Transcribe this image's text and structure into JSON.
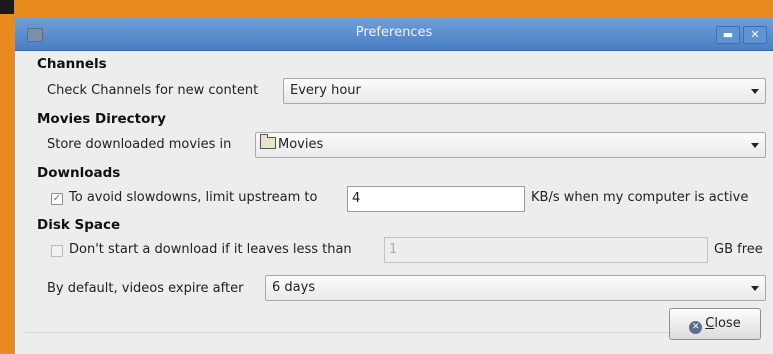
{
  "window": {
    "title": "Preferences",
    "minimize_glyph": "▬",
    "close_glyph": "✕"
  },
  "channels": {
    "heading": "Channels",
    "check_label": "Check Channels for new content",
    "check_value": "Every hour"
  },
  "movies": {
    "heading": "Movies Directory",
    "store_label": "Store downloaded movies in",
    "store_value": "Movies"
  },
  "downloads": {
    "heading": "Downloads",
    "limit_checked": true,
    "limit_check_glyph": "✓",
    "limit_label": "To avoid slowdowns, limit upstream to",
    "limit_value": "4",
    "limit_suffix": "KB/s when my computer is active"
  },
  "disk": {
    "heading": "Disk Space",
    "space_checked": false,
    "space_label": "Don't start a download if it leaves less than",
    "space_value": "1",
    "space_suffix": "GB free",
    "expire_label": "By default, videos expire after",
    "expire_value": "6 days"
  },
  "buttons": {
    "close_icon_glyph": "✕",
    "close_mnemonic": "C",
    "close_rest": "lose"
  }
}
